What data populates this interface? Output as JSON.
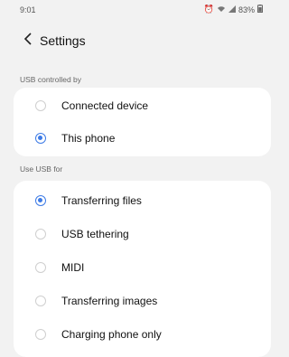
{
  "status_bar": {
    "time": "9:01",
    "battery": "83%",
    "icons": [
      "alarm-icon",
      "wifi-icon",
      "signal-icon",
      "battery-icon"
    ]
  },
  "header": {
    "back_icon": "chevron-left-icon",
    "title": "Settings"
  },
  "usb_controlled_by": {
    "label": "USB controlled by",
    "options": [
      {
        "label": "Connected device",
        "selected": false
      },
      {
        "label": "This phone",
        "selected": true
      }
    ]
  },
  "use_usb_for": {
    "label": "Use USB for",
    "options": [
      {
        "label": "Transferring files",
        "selected": true
      },
      {
        "label": "USB tethering",
        "selected": false
      },
      {
        "label": "MIDI",
        "selected": false
      },
      {
        "label": "Transferring images",
        "selected": false
      },
      {
        "label": "Charging phone only",
        "selected": false
      }
    ]
  },
  "colors": {
    "accent": "#3d7be6",
    "background": "#f2f2f2",
    "card": "#ffffff"
  }
}
